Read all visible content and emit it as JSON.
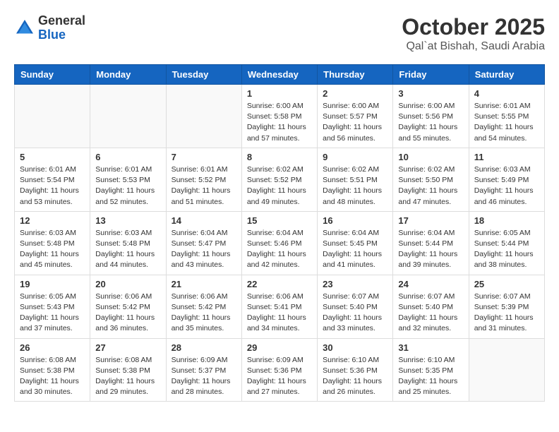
{
  "header": {
    "logo_general": "General",
    "logo_blue": "Blue",
    "month_title": "October 2025",
    "location": "Qal`at Bishah, Saudi Arabia"
  },
  "days_of_week": [
    "Sunday",
    "Monday",
    "Tuesday",
    "Wednesday",
    "Thursday",
    "Friday",
    "Saturday"
  ],
  "weeks": [
    [
      {
        "day": "",
        "info": ""
      },
      {
        "day": "",
        "info": ""
      },
      {
        "day": "",
        "info": ""
      },
      {
        "day": "1",
        "info": "Sunrise: 6:00 AM\nSunset: 5:58 PM\nDaylight: 11 hours and 57 minutes."
      },
      {
        "day": "2",
        "info": "Sunrise: 6:00 AM\nSunset: 5:57 PM\nDaylight: 11 hours and 56 minutes."
      },
      {
        "day": "3",
        "info": "Sunrise: 6:00 AM\nSunset: 5:56 PM\nDaylight: 11 hours and 55 minutes."
      },
      {
        "day": "4",
        "info": "Sunrise: 6:01 AM\nSunset: 5:55 PM\nDaylight: 11 hours and 54 minutes."
      }
    ],
    [
      {
        "day": "5",
        "info": "Sunrise: 6:01 AM\nSunset: 5:54 PM\nDaylight: 11 hours and 53 minutes."
      },
      {
        "day": "6",
        "info": "Sunrise: 6:01 AM\nSunset: 5:53 PM\nDaylight: 11 hours and 52 minutes."
      },
      {
        "day": "7",
        "info": "Sunrise: 6:01 AM\nSunset: 5:52 PM\nDaylight: 11 hours and 51 minutes."
      },
      {
        "day": "8",
        "info": "Sunrise: 6:02 AM\nSunset: 5:52 PM\nDaylight: 11 hours and 49 minutes."
      },
      {
        "day": "9",
        "info": "Sunrise: 6:02 AM\nSunset: 5:51 PM\nDaylight: 11 hours and 48 minutes."
      },
      {
        "day": "10",
        "info": "Sunrise: 6:02 AM\nSunset: 5:50 PM\nDaylight: 11 hours and 47 minutes."
      },
      {
        "day": "11",
        "info": "Sunrise: 6:03 AM\nSunset: 5:49 PM\nDaylight: 11 hours and 46 minutes."
      }
    ],
    [
      {
        "day": "12",
        "info": "Sunrise: 6:03 AM\nSunset: 5:48 PM\nDaylight: 11 hours and 45 minutes."
      },
      {
        "day": "13",
        "info": "Sunrise: 6:03 AM\nSunset: 5:48 PM\nDaylight: 11 hours and 44 minutes."
      },
      {
        "day": "14",
        "info": "Sunrise: 6:04 AM\nSunset: 5:47 PM\nDaylight: 11 hours and 43 minutes."
      },
      {
        "day": "15",
        "info": "Sunrise: 6:04 AM\nSunset: 5:46 PM\nDaylight: 11 hours and 42 minutes."
      },
      {
        "day": "16",
        "info": "Sunrise: 6:04 AM\nSunset: 5:45 PM\nDaylight: 11 hours and 41 minutes."
      },
      {
        "day": "17",
        "info": "Sunrise: 6:04 AM\nSunset: 5:44 PM\nDaylight: 11 hours and 39 minutes."
      },
      {
        "day": "18",
        "info": "Sunrise: 6:05 AM\nSunset: 5:44 PM\nDaylight: 11 hours and 38 minutes."
      }
    ],
    [
      {
        "day": "19",
        "info": "Sunrise: 6:05 AM\nSunset: 5:43 PM\nDaylight: 11 hours and 37 minutes."
      },
      {
        "day": "20",
        "info": "Sunrise: 6:06 AM\nSunset: 5:42 PM\nDaylight: 11 hours and 36 minutes."
      },
      {
        "day": "21",
        "info": "Sunrise: 6:06 AM\nSunset: 5:42 PM\nDaylight: 11 hours and 35 minutes."
      },
      {
        "day": "22",
        "info": "Sunrise: 6:06 AM\nSunset: 5:41 PM\nDaylight: 11 hours and 34 minutes."
      },
      {
        "day": "23",
        "info": "Sunrise: 6:07 AM\nSunset: 5:40 PM\nDaylight: 11 hours and 33 minutes."
      },
      {
        "day": "24",
        "info": "Sunrise: 6:07 AM\nSunset: 5:40 PM\nDaylight: 11 hours and 32 minutes."
      },
      {
        "day": "25",
        "info": "Sunrise: 6:07 AM\nSunset: 5:39 PM\nDaylight: 11 hours and 31 minutes."
      }
    ],
    [
      {
        "day": "26",
        "info": "Sunrise: 6:08 AM\nSunset: 5:38 PM\nDaylight: 11 hours and 30 minutes."
      },
      {
        "day": "27",
        "info": "Sunrise: 6:08 AM\nSunset: 5:38 PM\nDaylight: 11 hours and 29 minutes."
      },
      {
        "day": "28",
        "info": "Sunrise: 6:09 AM\nSunset: 5:37 PM\nDaylight: 11 hours and 28 minutes."
      },
      {
        "day": "29",
        "info": "Sunrise: 6:09 AM\nSunset: 5:36 PM\nDaylight: 11 hours and 27 minutes."
      },
      {
        "day": "30",
        "info": "Sunrise: 6:10 AM\nSunset: 5:36 PM\nDaylight: 11 hours and 26 minutes."
      },
      {
        "day": "31",
        "info": "Sunrise: 6:10 AM\nSunset: 5:35 PM\nDaylight: 11 hours and 25 minutes."
      },
      {
        "day": "",
        "info": ""
      }
    ]
  ]
}
